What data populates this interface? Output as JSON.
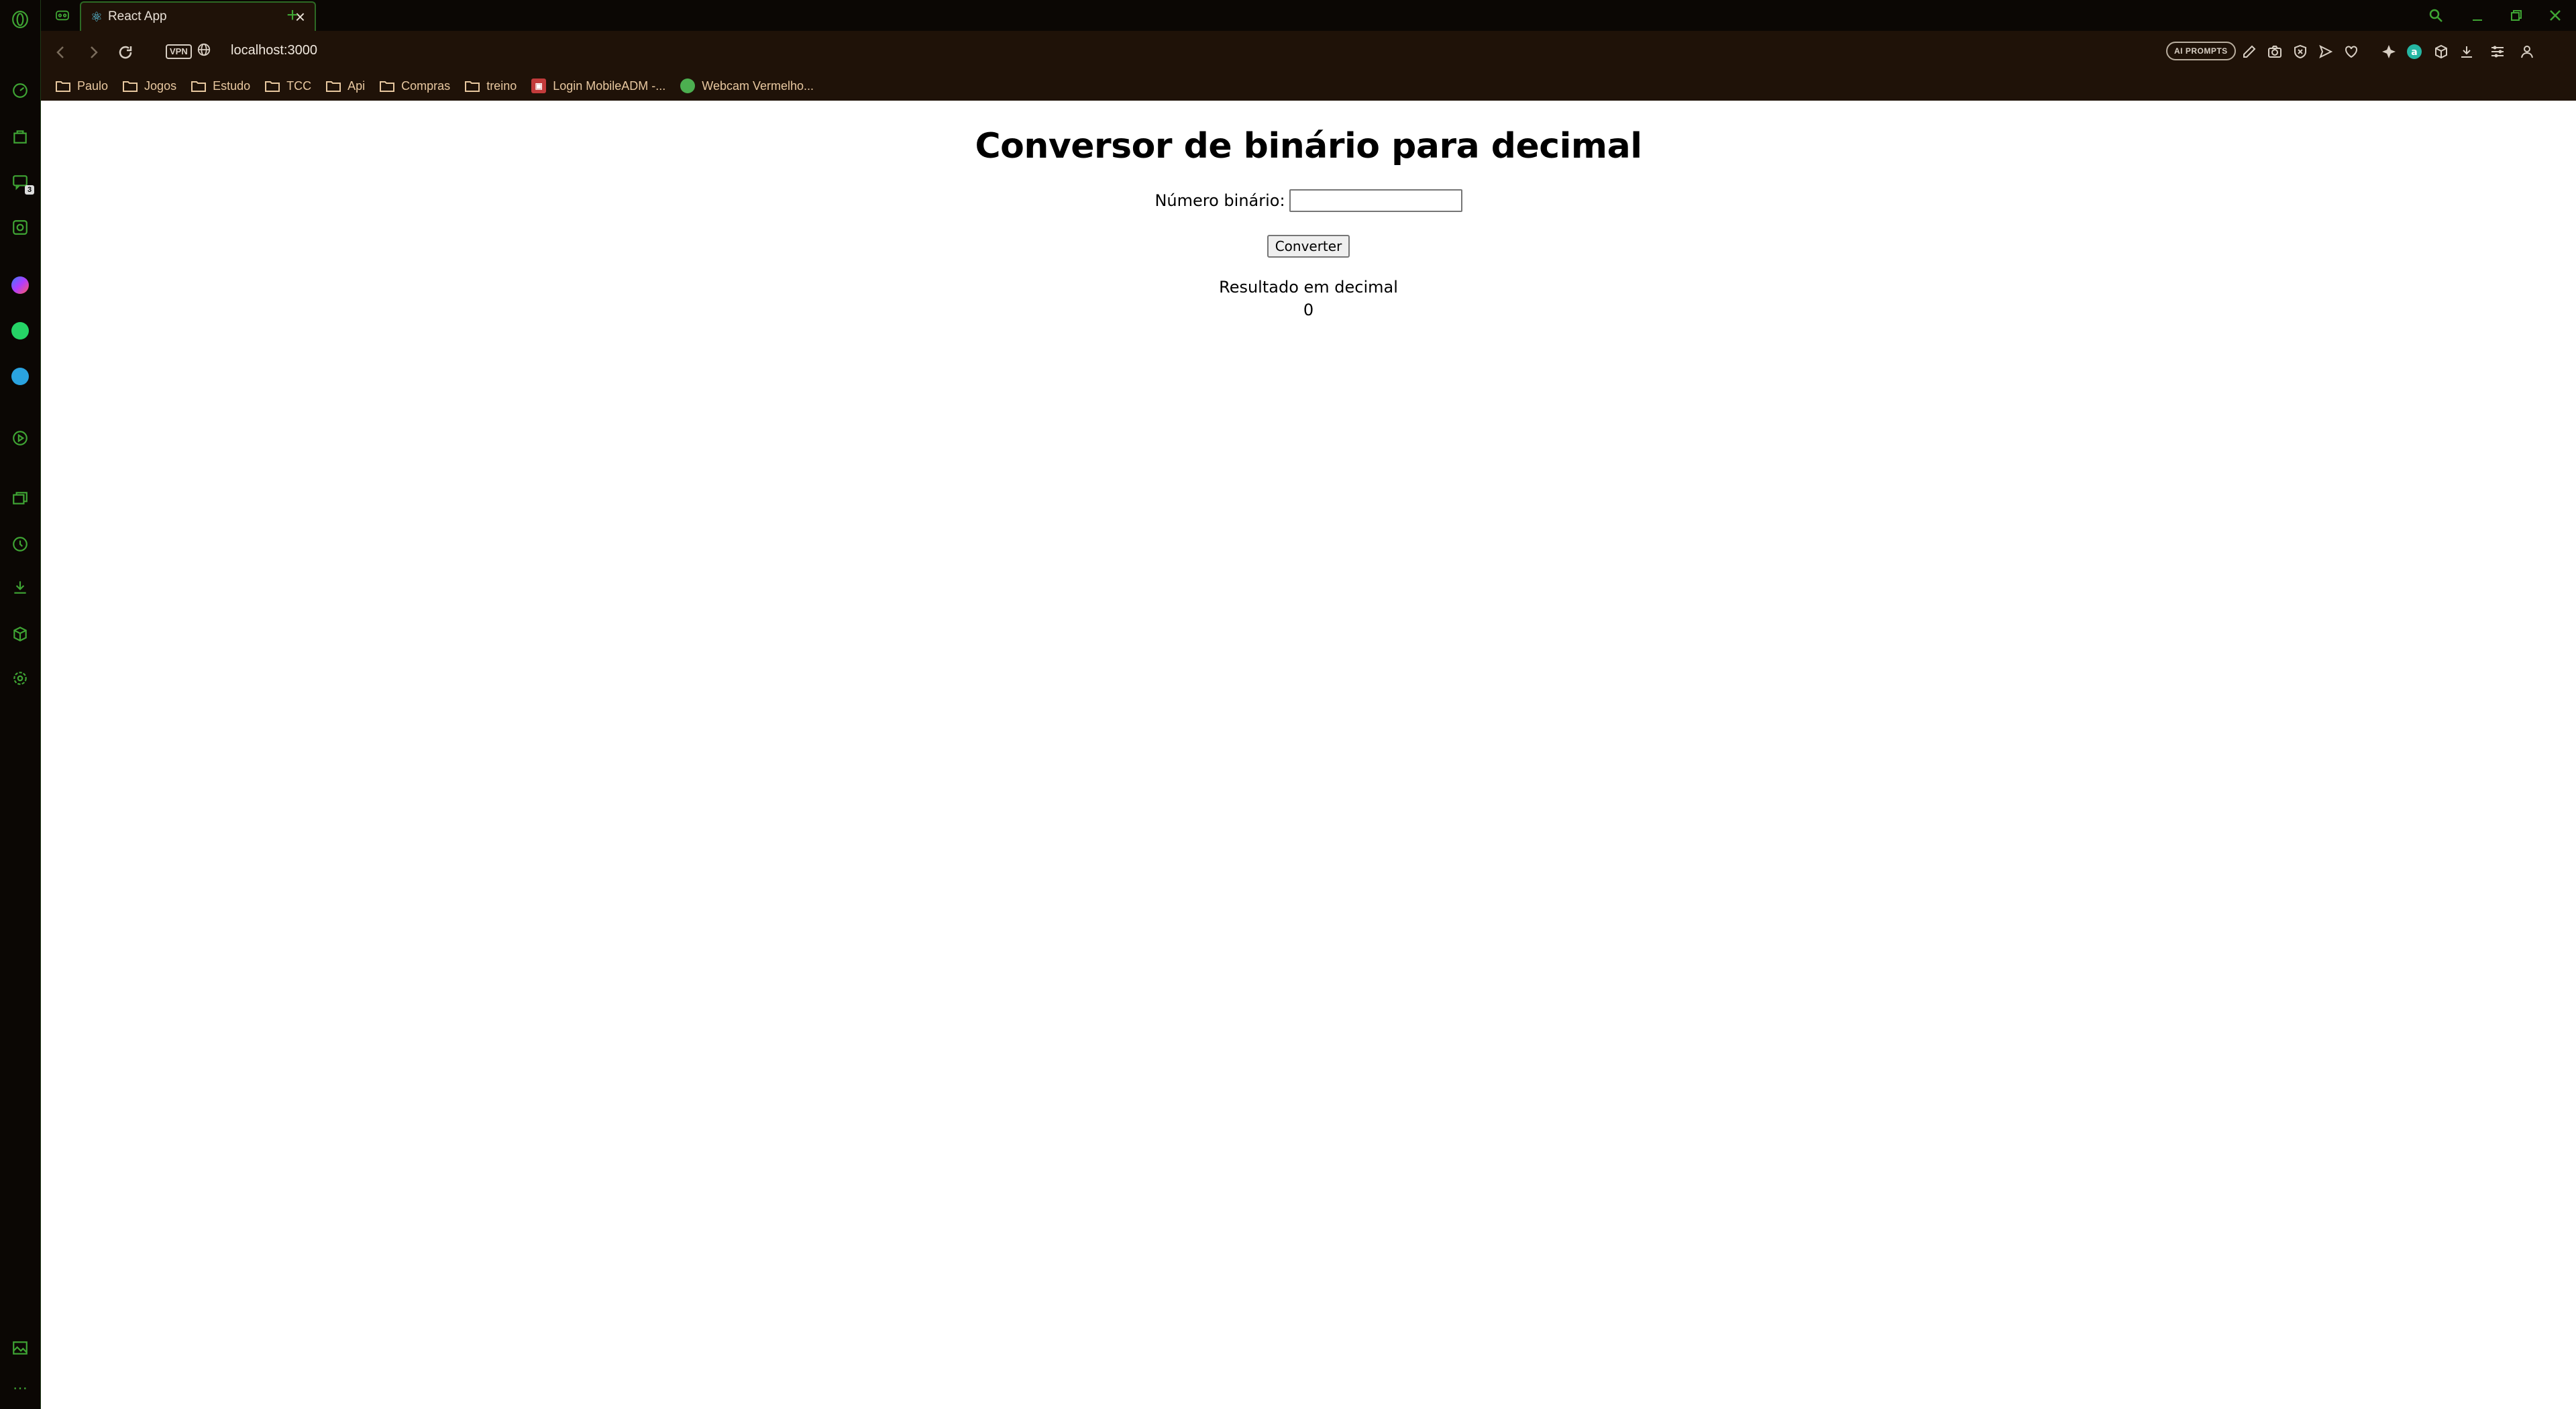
{
  "browser": {
    "tab": {
      "title": "React App",
      "close": "×"
    },
    "new_tab": "+",
    "address": {
      "vpn": "VPN",
      "url": "localhost:3000"
    },
    "ai_prompts": "AI PROMPTS",
    "accent_color": "#3fa534"
  },
  "sidebar": {
    "messenger_badge": "3"
  },
  "bookmarks": [
    {
      "label": "Paulo",
      "icon": "folder-icon"
    },
    {
      "label": "Jogos",
      "icon": "folder-icon"
    },
    {
      "label": "Estudo",
      "icon": "folder-icon"
    },
    {
      "label": "TCC",
      "icon": "folder-icon"
    },
    {
      "label": "Api",
      "icon": "folder-icon"
    },
    {
      "label": "Compras",
      "icon": "folder-icon"
    },
    {
      "label": "treino",
      "icon": "folder-icon"
    },
    {
      "label": "Login MobileADM -...",
      "icon": "site-favicon"
    },
    {
      "label": "Webcam Vermelho...",
      "icon": "webcam-favicon"
    }
  ],
  "page": {
    "title": "Conversor de binário para decimal",
    "input_label": "Número binário:",
    "input_value": "",
    "button_label": "Converter",
    "result_label": "Resultado em decimal",
    "result_value": "0"
  }
}
